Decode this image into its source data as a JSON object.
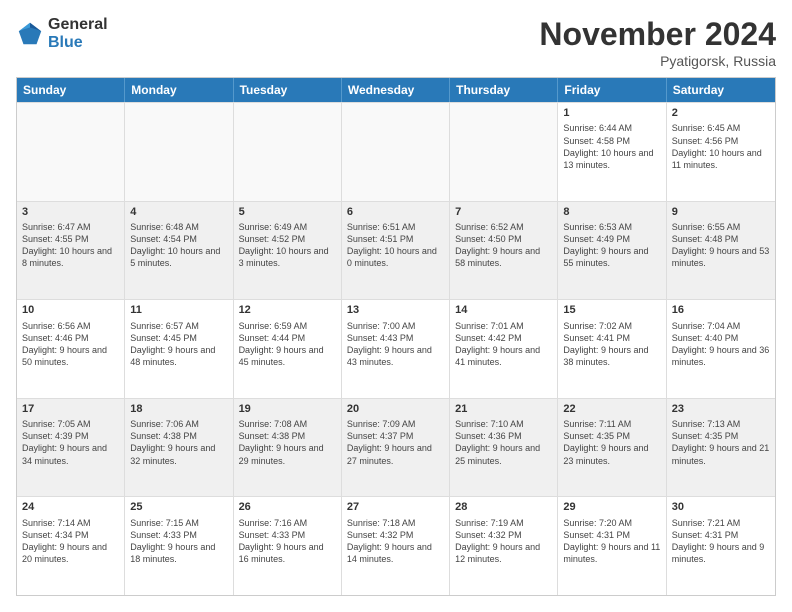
{
  "logo": {
    "general": "General",
    "blue": "Blue"
  },
  "title": "November 2024",
  "location": "Pyatigorsk, Russia",
  "days": [
    "Sunday",
    "Monday",
    "Tuesday",
    "Wednesday",
    "Thursday",
    "Friday",
    "Saturday"
  ],
  "rows": [
    [
      {
        "day": "",
        "info": ""
      },
      {
        "day": "",
        "info": ""
      },
      {
        "day": "",
        "info": ""
      },
      {
        "day": "",
        "info": ""
      },
      {
        "day": "",
        "info": ""
      },
      {
        "day": "1",
        "info": "Sunrise: 6:44 AM\nSunset: 4:58 PM\nDaylight: 10 hours and 13 minutes."
      },
      {
        "day": "2",
        "info": "Sunrise: 6:45 AM\nSunset: 4:56 PM\nDaylight: 10 hours and 11 minutes."
      }
    ],
    [
      {
        "day": "3",
        "info": "Sunrise: 6:47 AM\nSunset: 4:55 PM\nDaylight: 10 hours and 8 minutes."
      },
      {
        "day": "4",
        "info": "Sunrise: 6:48 AM\nSunset: 4:54 PM\nDaylight: 10 hours and 5 minutes."
      },
      {
        "day": "5",
        "info": "Sunrise: 6:49 AM\nSunset: 4:52 PM\nDaylight: 10 hours and 3 minutes."
      },
      {
        "day": "6",
        "info": "Sunrise: 6:51 AM\nSunset: 4:51 PM\nDaylight: 10 hours and 0 minutes."
      },
      {
        "day": "7",
        "info": "Sunrise: 6:52 AM\nSunset: 4:50 PM\nDaylight: 9 hours and 58 minutes."
      },
      {
        "day": "8",
        "info": "Sunrise: 6:53 AM\nSunset: 4:49 PM\nDaylight: 9 hours and 55 minutes."
      },
      {
        "day": "9",
        "info": "Sunrise: 6:55 AM\nSunset: 4:48 PM\nDaylight: 9 hours and 53 minutes."
      }
    ],
    [
      {
        "day": "10",
        "info": "Sunrise: 6:56 AM\nSunset: 4:46 PM\nDaylight: 9 hours and 50 minutes."
      },
      {
        "day": "11",
        "info": "Sunrise: 6:57 AM\nSunset: 4:45 PM\nDaylight: 9 hours and 48 minutes."
      },
      {
        "day": "12",
        "info": "Sunrise: 6:59 AM\nSunset: 4:44 PM\nDaylight: 9 hours and 45 minutes."
      },
      {
        "day": "13",
        "info": "Sunrise: 7:00 AM\nSunset: 4:43 PM\nDaylight: 9 hours and 43 minutes."
      },
      {
        "day": "14",
        "info": "Sunrise: 7:01 AM\nSunset: 4:42 PM\nDaylight: 9 hours and 41 minutes."
      },
      {
        "day": "15",
        "info": "Sunrise: 7:02 AM\nSunset: 4:41 PM\nDaylight: 9 hours and 38 minutes."
      },
      {
        "day": "16",
        "info": "Sunrise: 7:04 AM\nSunset: 4:40 PM\nDaylight: 9 hours and 36 minutes."
      }
    ],
    [
      {
        "day": "17",
        "info": "Sunrise: 7:05 AM\nSunset: 4:39 PM\nDaylight: 9 hours and 34 minutes."
      },
      {
        "day": "18",
        "info": "Sunrise: 7:06 AM\nSunset: 4:38 PM\nDaylight: 9 hours and 32 minutes."
      },
      {
        "day": "19",
        "info": "Sunrise: 7:08 AM\nSunset: 4:38 PM\nDaylight: 9 hours and 29 minutes."
      },
      {
        "day": "20",
        "info": "Sunrise: 7:09 AM\nSunset: 4:37 PM\nDaylight: 9 hours and 27 minutes."
      },
      {
        "day": "21",
        "info": "Sunrise: 7:10 AM\nSunset: 4:36 PM\nDaylight: 9 hours and 25 minutes."
      },
      {
        "day": "22",
        "info": "Sunrise: 7:11 AM\nSunset: 4:35 PM\nDaylight: 9 hours and 23 minutes."
      },
      {
        "day": "23",
        "info": "Sunrise: 7:13 AM\nSunset: 4:35 PM\nDaylight: 9 hours and 21 minutes."
      }
    ],
    [
      {
        "day": "24",
        "info": "Sunrise: 7:14 AM\nSunset: 4:34 PM\nDaylight: 9 hours and 20 minutes."
      },
      {
        "day": "25",
        "info": "Sunrise: 7:15 AM\nSunset: 4:33 PM\nDaylight: 9 hours and 18 minutes."
      },
      {
        "day": "26",
        "info": "Sunrise: 7:16 AM\nSunset: 4:33 PM\nDaylight: 9 hours and 16 minutes."
      },
      {
        "day": "27",
        "info": "Sunrise: 7:18 AM\nSunset: 4:32 PM\nDaylight: 9 hours and 14 minutes."
      },
      {
        "day": "28",
        "info": "Sunrise: 7:19 AM\nSunset: 4:32 PM\nDaylight: 9 hours and 12 minutes."
      },
      {
        "day": "29",
        "info": "Sunrise: 7:20 AM\nSunset: 4:31 PM\nDaylight: 9 hours and 11 minutes."
      },
      {
        "day": "30",
        "info": "Sunrise: 7:21 AM\nSunset: 4:31 PM\nDaylight: 9 hours and 9 minutes."
      }
    ]
  ]
}
